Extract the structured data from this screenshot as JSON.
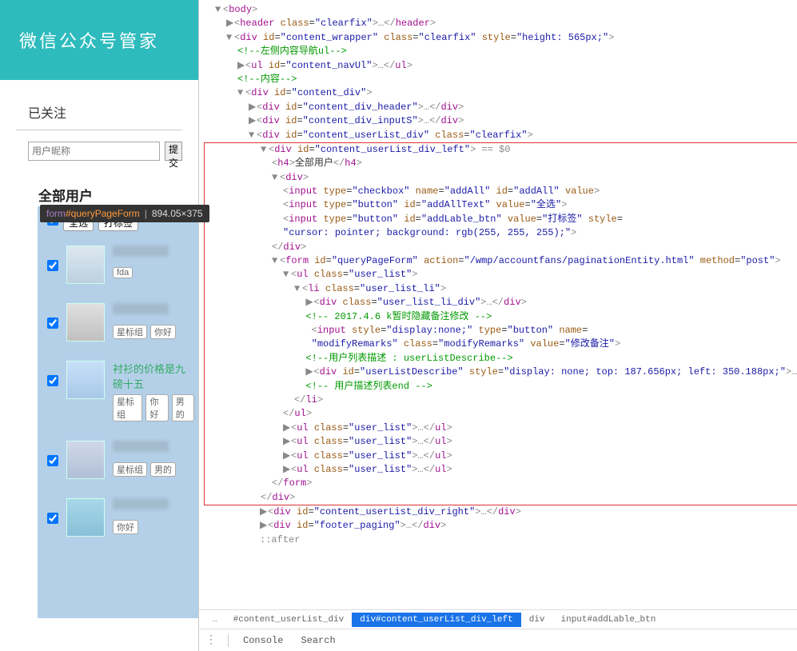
{
  "app": {
    "title": "微信公众号管家",
    "section": "已关注",
    "search_placeholder": "用户昵称",
    "submit": "提交",
    "all_users": "全部用户",
    "top_button1": "全选",
    "top_button2": "打标签",
    "tooltip_type": "form",
    "tooltip_id": "#queryPageForm",
    "tooltip_dims": "894.05×375"
  },
  "users": [
    {
      "tags": [
        "fda"
      ],
      "nick": ""
    },
    {
      "tags": [
        "星标组",
        "你好"
      ],
      "nick": ""
    },
    {
      "tags": [
        "星标组",
        "你好",
        "男的"
      ],
      "nick": "衬衫的价格是九磅十五"
    },
    {
      "tags": [
        "星标组",
        "男的"
      ],
      "nick": ""
    },
    {
      "tags": [
        "你好"
      ],
      "nick": ""
    }
  ],
  "dom": {
    "body": "body",
    "header_tag": "header",
    "header_cls": "clearfix",
    "wrapper_id": "content_wrapper",
    "wrapper_cls": "clearfix",
    "wrapper_style": "height: 565px;",
    "comment_left": "左侧内容导航ul",
    "navul_id": "content_navUl",
    "comment_content": "内容",
    "cdiv": "content_div",
    "cdiv_header": "content_div_header",
    "cdiv_inputs": "content_div_inputS",
    "ulist_div": "content_userList_div",
    "clearfix": "clearfix",
    "ulist_left": "content_userList_div_left",
    "eq": " == $0",
    "h4_text": "全部用户",
    "cb_name": "addAll",
    "cb_id": "addAll",
    "btn1_id": "addAllText",
    "btn1_val": "全选",
    "btn2_id": "addLable_btn",
    "btn2_val": "打标签",
    "btn2_style": "cursor: pointer; background: rgb(255, 255, 255);",
    "form_id": "queryPageForm",
    "form_action": "/wmp/accountfans/paginationEntity.html",
    "form_method": "post",
    "ul_cls": "user_list",
    "li_cls": "user_list_li",
    "li_div_cls": "user_list_li_div",
    "c_date": " 2017.4.6 k暂时隐藏备注修改 ",
    "mod_name": "modifyRemarks",
    "mod_cls": "modifyRemarks",
    "mod_val": "修改备注",
    "mod_style": "display:none;",
    "c_desc1": "用户列表描述 : userListDescribe",
    "desc_id": "userListDescribe",
    "desc_style": "display: none; top: 187.656px; left: 350.188px;",
    "c_desc_end": " 用户描述列表end ",
    "ulist_right": "content_userList_div_right",
    "footer": "footer_paging",
    "after": "::after"
  },
  "crumbs": {
    "c1": "#content_userList_div",
    "c2": "div#content_userList_div_left",
    "c3": "div",
    "c4": "input#addLable_btn"
  },
  "tabs": {
    "console": "Console",
    "search": "Search"
  }
}
